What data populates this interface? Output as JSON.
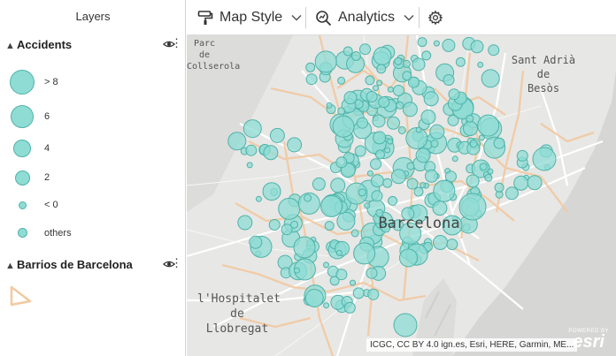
{
  "panel": {
    "title": "Layers",
    "groups": [
      {
        "name": "Accidents",
        "legend": [
          {
            "label": "> 8"
          },
          {
            "label": "6"
          },
          {
            "label": "4"
          },
          {
            "label": "2"
          },
          {
            "label": "< 0"
          },
          {
            "label": "others"
          }
        ]
      },
      {
        "name": "Barrios de Barcelona"
      }
    ]
  },
  "toolbar": {
    "map_style_label": "Map Style",
    "analytics_label": "Analytics"
  },
  "map": {
    "labels": {
      "parc": "Parc de\nCollserola",
      "sant_adria": "Sant Adrià\nde\nBesòs",
      "barcelona": "Barcelona",
      "hospitalet": "l'Hospitalet\nde\nLlobregat"
    },
    "attribution": "ICGC, CC BY 4.0 ign.es, Esri, HERE, Garmin, ME...",
    "logo": {
      "top": "POWERED BY",
      "brand": "esri"
    }
  },
  "colors": {
    "marker_fill": "#8fdcd4",
    "marker_stroke": "#4fb3a9",
    "boundary": "#f2c9a1",
    "land": "#e7e7e5",
    "sea": "#d5d5d3"
  }
}
